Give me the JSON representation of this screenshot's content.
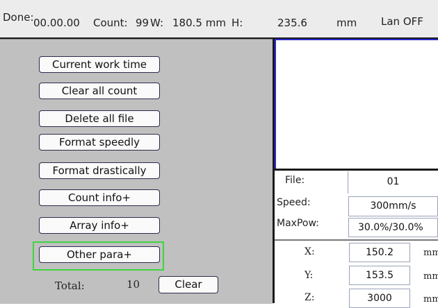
{
  "status_bar": {
    "done_label": "Done:",
    "done_value": "00.00.00",
    "count_label": "Count:",
    "count_value": "99",
    "width_label": "W:",
    "width_value": "180.5 mm",
    "height_label": "H:",
    "height_value": "235.6",
    "unit": "mm",
    "lan_status": "Lan OFF"
  },
  "menu": {
    "buttons": [
      "Current work time",
      "Clear all count",
      "Delete all file",
      "Format speedly",
      "Format drastically",
      "Count info+",
      "Array info+",
      "Other para+"
    ],
    "selected_button": "Other para+",
    "highlight_color": "#3ed43e"
  },
  "total": {
    "label": "Total:",
    "value": "10",
    "clear_label": "Clear"
  },
  "file_info": {
    "file_label": "File:",
    "file_value": "01",
    "speed_label": "Speed:",
    "speed_value": "300mm/s",
    "maxpow_label": "MaxPow:",
    "maxpow_value": "30.0%/30.0%"
  },
  "coordinates": {
    "x_label": "X:",
    "x_value": "150.2",
    "y_label": "Y:",
    "y_value": "153.5",
    "z_label": "Z:",
    "z_value": "3000",
    "unit": "mm"
  },
  "colors": {
    "panel_bg": "#c0c0c0",
    "preview_border": "#2b2bd0"
  }
}
